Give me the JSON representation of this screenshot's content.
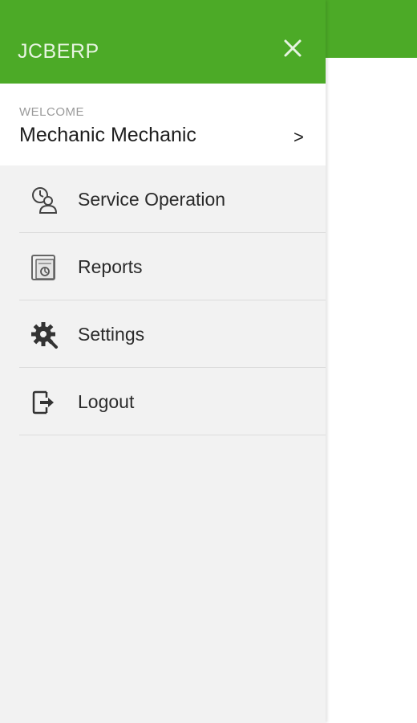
{
  "drawer": {
    "app_title": "JCBERP",
    "close_icon": "close-icon",
    "welcome_label": "WELCOME",
    "user_name": "Mechanic Mechanic",
    "chevron": ">"
  },
  "menu": {
    "items": [
      {
        "label": "Service Operation",
        "icon": "service-operation-icon"
      },
      {
        "label": "Reports",
        "icon": "reports-icon"
      },
      {
        "label": "Settings",
        "icon": "settings-icon"
      },
      {
        "label": "Logout",
        "icon": "logout-icon"
      }
    ]
  },
  "colors": {
    "brand_green": "#4caa27",
    "drawer_bg": "#f2f2f2"
  }
}
